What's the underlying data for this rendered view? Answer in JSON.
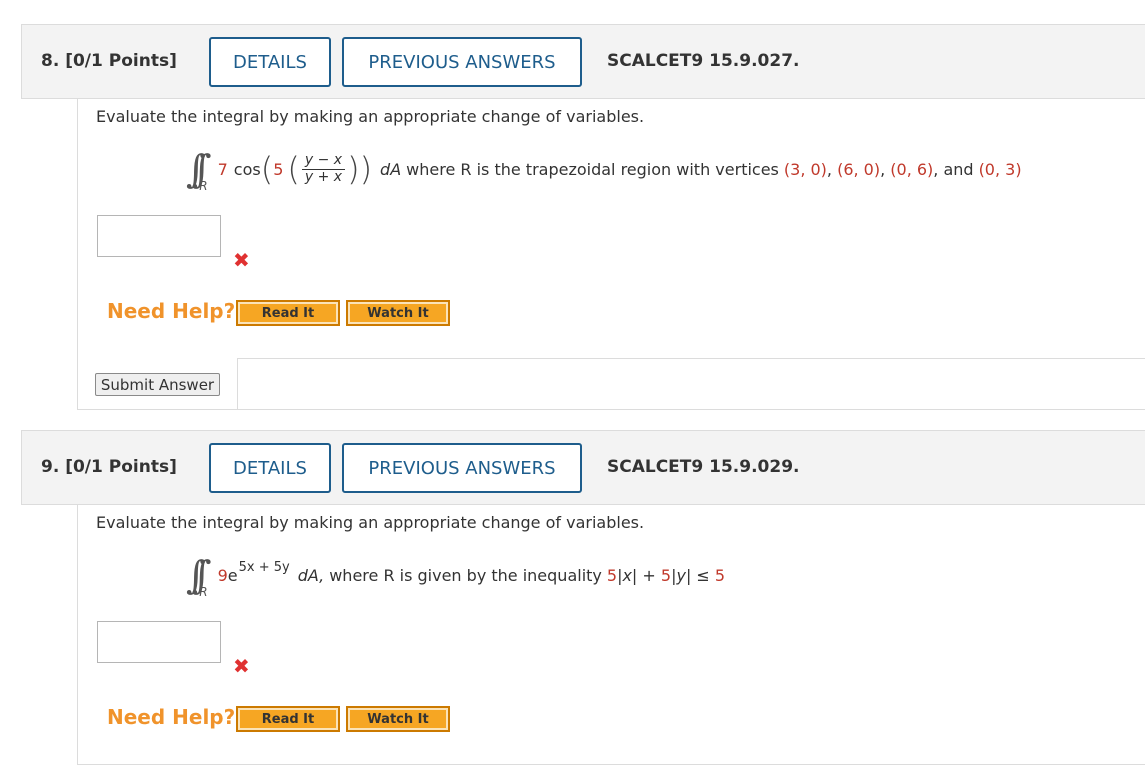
{
  "questions": [
    {
      "number_label": "8. [0/1 Points]",
      "details_label": "DETAILS",
      "previous_answers_label": "PREVIOUS ANSWERS",
      "code": "SCALCET9 15.9.027.",
      "prompt": "Evaluate the integral by making an appropriate change of variables.",
      "math": {
        "coef": "7",
        "func": "cos",
        "inner_coef": "5",
        "numerator": "y − x",
        "denominator": "y + x",
        "region_symbol": "R",
        "differential": "dA",
        "where_text": "where R is the trapezoidal region with vertices",
        "vertices": [
          "(3, 0)",
          "(6, 0)",
          "(0, 6)",
          "(0, 3)"
        ],
        "and_text": "and"
      },
      "answer_value": "",
      "status_icon": "x-icon",
      "need_help_label": "Need Help?",
      "read_it_label": "Read It",
      "watch_it_label": "Watch It",
      "submit_label": "Submit Answer"
    },
    {
      "number_label": "9. [0/1 Points]",
      "details_label": "DETAILS",
      "previous_answers_label": "PREVIOUS ANSWERS",
      "code": "SCALCET9 15.9.029.",
      "prompt": "Evaluate the integral by making an appropriate change of variables.",
      "math": {
        "coef": "9",
        "base": "e",
        "exponent": "5x + 5y",
        "region_symbol": "R",
        "differential": "dA,",
        "where_text": "where R is given by the inequality",
        "ineq_a": "5",
        "ineq_b": "5",
        "ineq_rhs": "5"
      },
      "answer_value": "",
      "status_icon": "x-icon",
      "need_help_label": "Need Help?",
      "read_it_label": "Read It",
      "watch_it_label": "Watch It"
    }
  ],
  "colors": {
    "accent_blue": "#1e5d8c",
    "help_orange": "#f0932b",
    "button_orange": "#f6a623",
    "incorrect_red": "#e03131",
    "value_red": "#c0392b"
  }
}
